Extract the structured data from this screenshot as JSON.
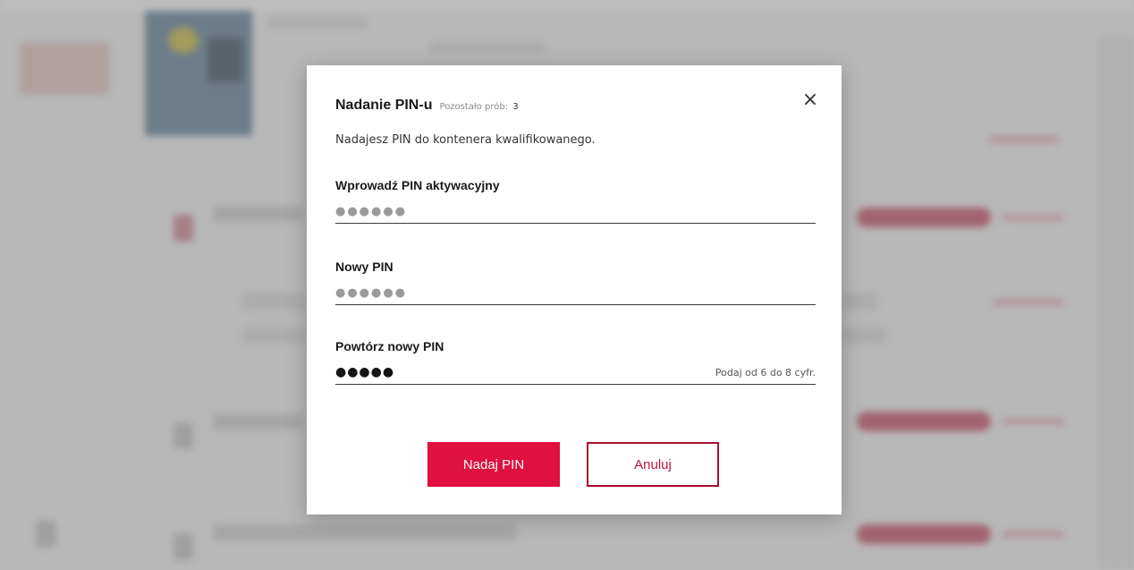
{
  "modal": {
    "title": "Nadanie PIN-u",
    "attempts_label": "Pozostało prób:",
    "attempts_count": "3",
    "close_icon": "×",
    "description": "Nadajesz PIN do kontenera kwalifikowanego."
  },
  "fields": {
    "activation_pin": {
      "label": "Wprowadź PIN aktywacyjny",
      "mask": "●●●●●●"
    },
    "new_pin": {
      "label": "Nowy PIN",
      "mask": "●●●●●●"
    },
    "repeat_pin": {
      "label": "Powtórz nowy PIN",
      "mask": "●●●●●",
      "hint": "Podaj od 6 do 8 cyfr."
    }
  },
  "buttons": {
    "submit_label": "Nadaj PIN",
    "cancel_label": "Anuluj"
  },
  "colors": {
    "accent": "#e0103f",
    "cancel_border": "#a80f2f",
    "overlay": "#6e6e6e"
  }
}
